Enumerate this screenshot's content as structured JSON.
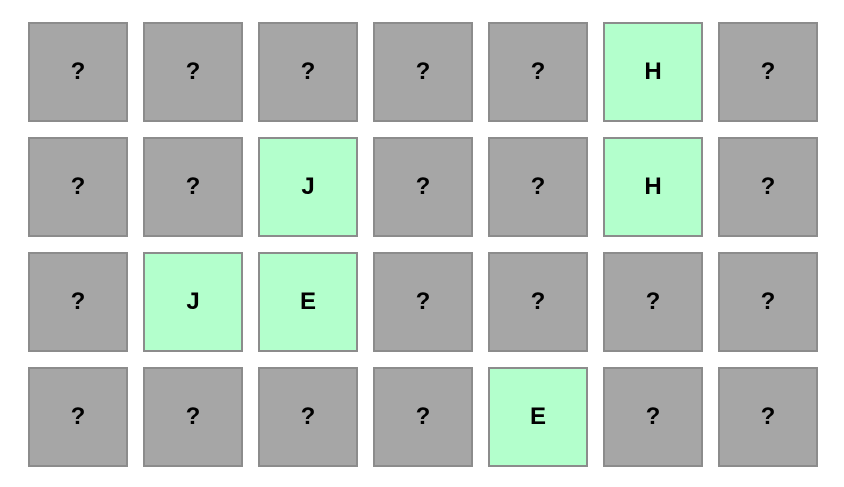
{
  "colors": {
    "hidden_card": "#a6a6a6",
    "revealed_card": "#b3ffcc",
    "card_border": "#8c8c8c",
    "text": "#000000"
  },
  "board": {
    "rows": [
      {
        "cards": [
          {
            "label": "?",
            "revealed": false
          },
          {
            "label": "?",
            "revealed": false
          },
          {
            "label": "?",
            "revealed": false
          },
          {
            "label": "?",
            "revealed": false
          },
          {
            "label": "?",
            "revealed": false
          },
          {
            "label": "H",
            "revealed": true
          },
          {
            "label": "?",
            "revealed": false
          }
        ]
      },
      {
        "cards": [
          {
            "label": "?",
            "revealed": false
          },
          {
            "label": "?",
            "revealed": false
          },
          {
            "label": "J",
            "revealed": true
          },
          {
            "label": "?",
            "revealed": false
          },
          {
            "label": "?",
            "revealed": false
          },
          {
            "label": "H",
            "revealed": true
          },
          {
            "label": "?",
            "revealed": false
          }
        ]
      },
      {
        "cards": [
          {
            "label": "?",
            "revealed": false
          },
          {
            "label": "J",
            "revealed": true
          },
          {
            "label": "E",
            "revealed": true
          },
          {
            "label": "?",
            "revealed": false
          },
          {
            "label": "?",
            "revealed": false
          },
          {
            "label": "?",
            "revealed": false
          },
          {
            "label": "?",
            "revealed": false
          }
        ]
      },
      {
        "cards": [
          {
            "label": "?",
            "revealed": false
          },
          {
            "label": "?",
            "revealed": false
          },
          {
            "label": "?",
            "revealed": false
          },
          {
            "label": "?",
            "revealed": false
          },
          {
            "label": "E",
            "revealed": true
          },
          {
            "label": "?",
            "revealed": false
          },
          {
            "label": "?",
            "revealed": false
          }
        ]
      }
    ]
  }
}
